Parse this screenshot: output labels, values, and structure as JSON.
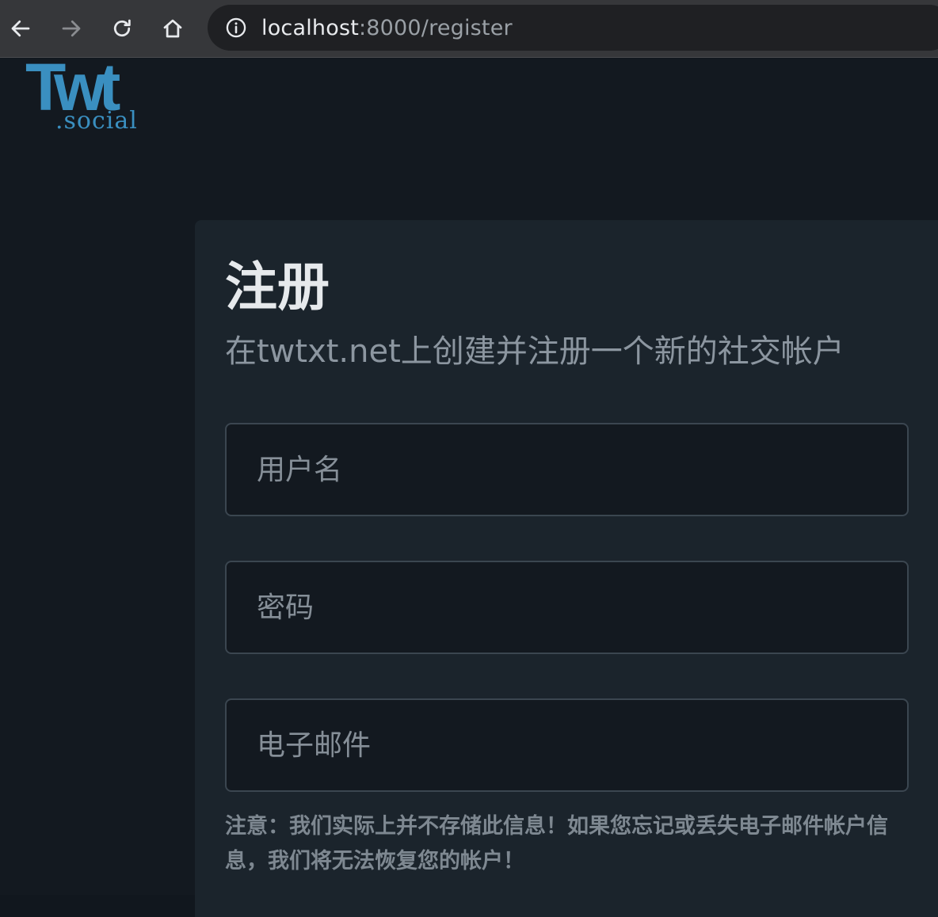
{
  "browser": {
    "url_host": "localhost",
    "url_rest": ":8000/register"
  },
  "logo": {
    "main": "Twt",
    "sub": ".social"
  },
  "register": {
    "title": "注册",
    "subtitle": "在twtxt.net上创建并注册一个新的社交帐户",
    "username_placeholder": "用户名",
    "password_placeholder": "密码",
    "email_placeholder": "电子邮件",
    "note": "注意：我们实际上并不存储此信息！如果您忘记或丢失电子邮件帐户信息，我们将无法恢复您的帐户！"
  },
  "colors": {
    "brand": "#3a8fc0",
    "page_bg": "#131920",
    "card_bg": "#1b242c"
  }
}
